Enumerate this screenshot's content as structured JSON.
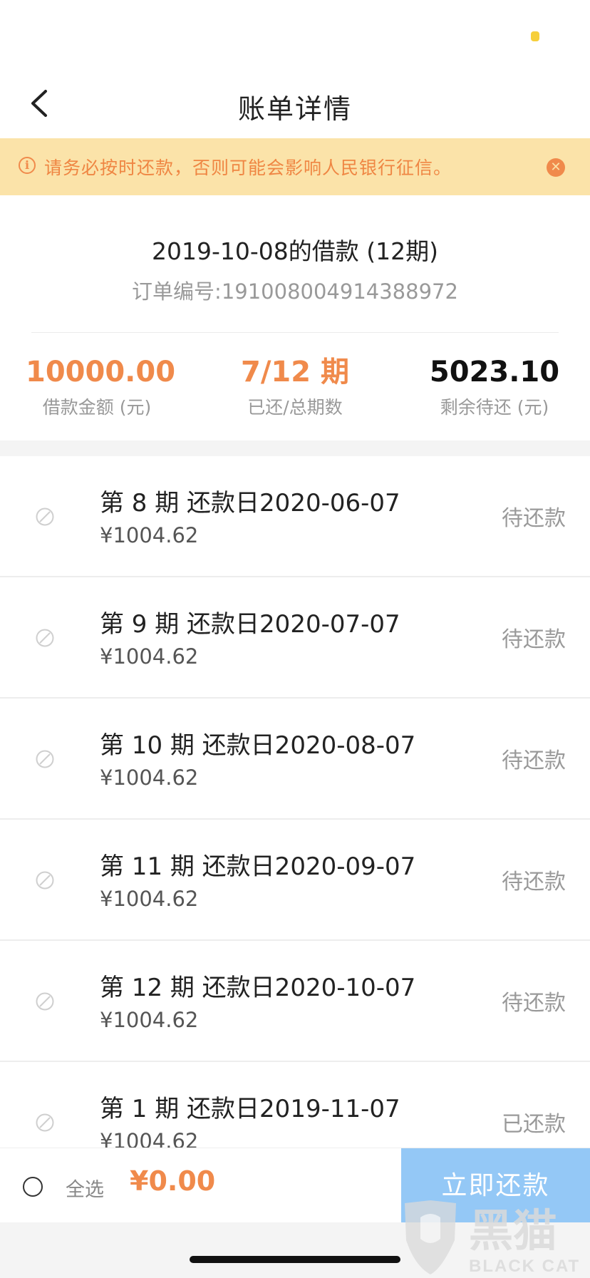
{
  "header": {
    "title": "账单详情"
  },
  "notice": {
    "text": "请务必按时还款，否则可能会影响人民银行征信。",
    "accent": "#f08a4b",
    "background": "#fbe3a9"
  },
  "loan": {
    "title": "2019-10-08的借款 (12期)",
    "order_no": "订单编号:191008004914388972",
    "stats": [
      {
        "value": "10000.00",
        "label": "借款金额 (元)",
        "color": "#f08a4b"
      },
      {
        "value": "7/12 期",
        "label": "已还/总期数",
        "color": "#f08a4b"
      },
      {
        "value": "5023.10",
        "label": "剩余待还 (元)",
        "color": "#111111"
      }
    ]
  },
  "installments": [
    {
      "title": "第 8 期  还款日2020-06-07",
      "amount": "¥1004.62",
      "status": "待还款"
    },
    {
      "title": "第 9 期  还款日2020-07-07",
      "amount": "¥1004.62",
      "status": "待还款"
    },
    {
      "title": "第 10 期  还款日2020-08-07",
      "amount": "¥1004.62",
      "status": "待还款"
    },
    {
      "title": "第 11 期  还款日2020-09-07",
      "amount": "¥1004.62",
      "status": "待还款"
    },
    {
      "title": "第 12 期  还款日2020-10-07",
      "amount": "¥1004.62",
      "status": "待还款"
    },
    {
      "title": "第 1 期  还款日2019-11-07",
      "amount": "¥1004.62",
      "status": "已还款"
    }
  ],
  "footer": {
    "select_all": "全选",
    "total": "¥0.00",
    "pay_button": "立即还款"
  },
  "watermark": {
    "text": "黑猫",
    "subtext": "BLACK CAT"
  }
}
